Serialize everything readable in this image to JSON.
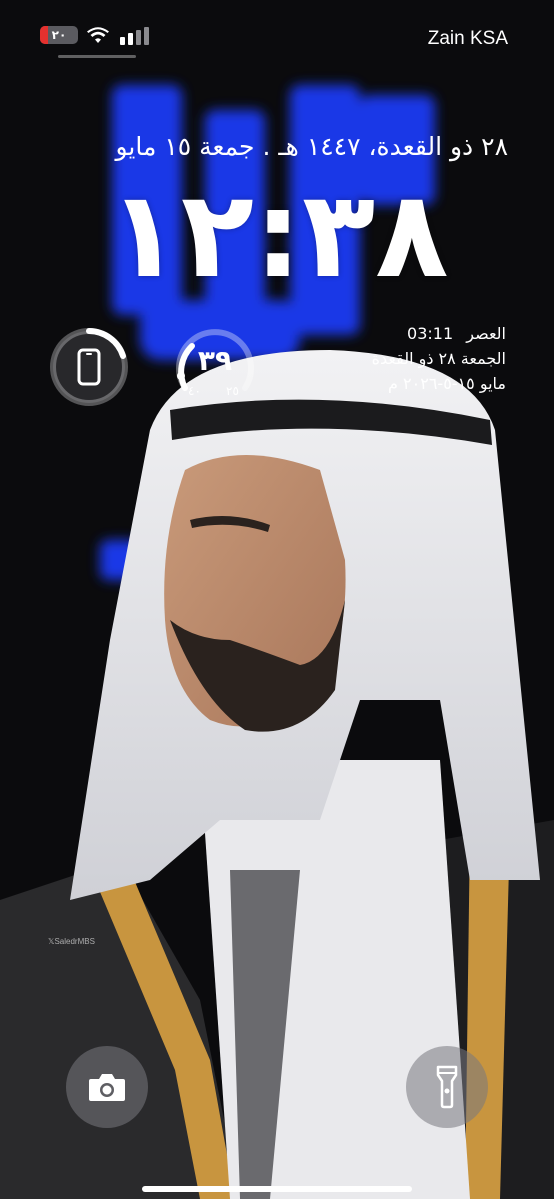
{
  "status_bar": {
    "carrier": "Zain KSA",
    "battery_level": "٢٠",
    "battery_color": "#e5312e"
  },
  "lock_screen": {
    "date_line": "٢٨ ذو القعدة، ١٤٤٧ هـ . جمعة ١٥ مايو",
    "time": "١٢:٣٨"
  },
  "widgets": {
    "phone_battery": {
      "icon": "phone-icon"
    },
    "temperature": {
      "current": "٣٩",
      "low": "٢٥",
      "high": "٤٠"
    },
    "prayer_info": {
      "line1_label": "العصر",
      "line1_time": "03:11",
      "line2": "الجمعة  ٢٨ ذو القعدة",
      "line3": "مايو  ١٥-٥-٢٠٢٦ م"
    }
  },
  "wallpaper": {
    "watermark": "𝕏SaledrMBS"
  },
  "controls": {
    "camera": "camera-icon",
    "flashlight": "flashlight-icon"
  }
}
